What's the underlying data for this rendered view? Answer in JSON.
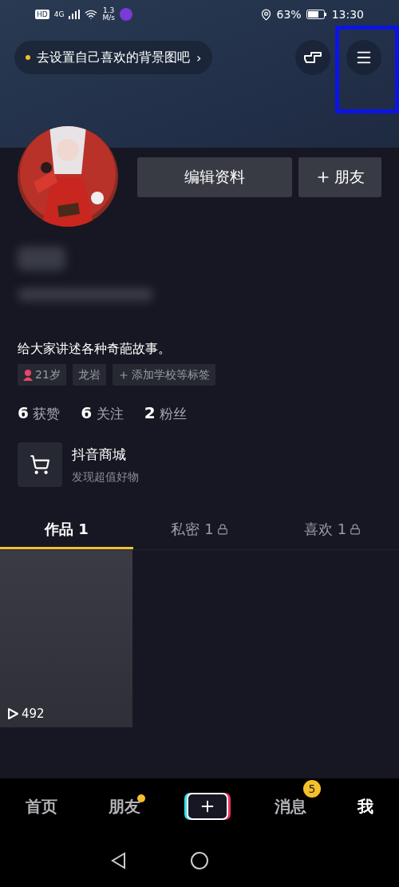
{
  "status_bar": {
    "hd_label": "HD",
    "network": "4G",
    "speed_value": "1.3",
    "speed_unit": "M/s",
    "battery": "63%",
    "time": "13:30"
  },
  "header": {
    "hint": "去设置自己喜欢的背景图吧",
    "hint_arrow": "›",
    "annotation": true
  },
  "profile": {
    "actions": [
      {
        "label": "编辑资料",
        "kind": "text"
      },
      {
        "label": "朋友",
        "kind": "add"
      }
    ],
    "bio": "给大家讲述各种奇葩故事。",
    "tags": [
      {
        "label": "21岁",
        "kind": "gender"
      },
      {
        "label": "龙岩",
        "kind": "plain"
      },
      {
        "label": "添加学校等标签",
        "kind": "add"
      }
    ],
    "stats": [
      "**6** 获赞",
      "**6** 关注",
      "**2** 粉丝"
    ],
    "shop": {
      "title": "抖音商城",
      "subtitle": "发现超值好物"
    }
  },
  "tabs": [
    {
      "label": "作品 1",
      "selected": true,
      "locked": false
    },
    {
      "label": "私密 1",
      "selected": false,
      "locked": true
    },
    {
      "label": "喜欢 1",
      "selected": false,
      "locked": true
    }
  ],
  "videos": [
    {
      "plays": "492"
    }
  ],
  "bottom_nav": [
    {
      "label": "首页",
      "kind": "text",
      "selected": false,
      "dot": false
    },
    {
      "label": "朋友",
      "kind": "text",
      "selected": false,
      "dot": true
    },
    {
      "kind": "create"
    },
    {
      "label": "消息",
      "kind": "text",
      "selected": false,
      "dot": false,
      "badge": "5"
    },
    {
      "label": "我",
      "kind": "text",
      "selected": true,
      "dot": false
    }
  ]
}
